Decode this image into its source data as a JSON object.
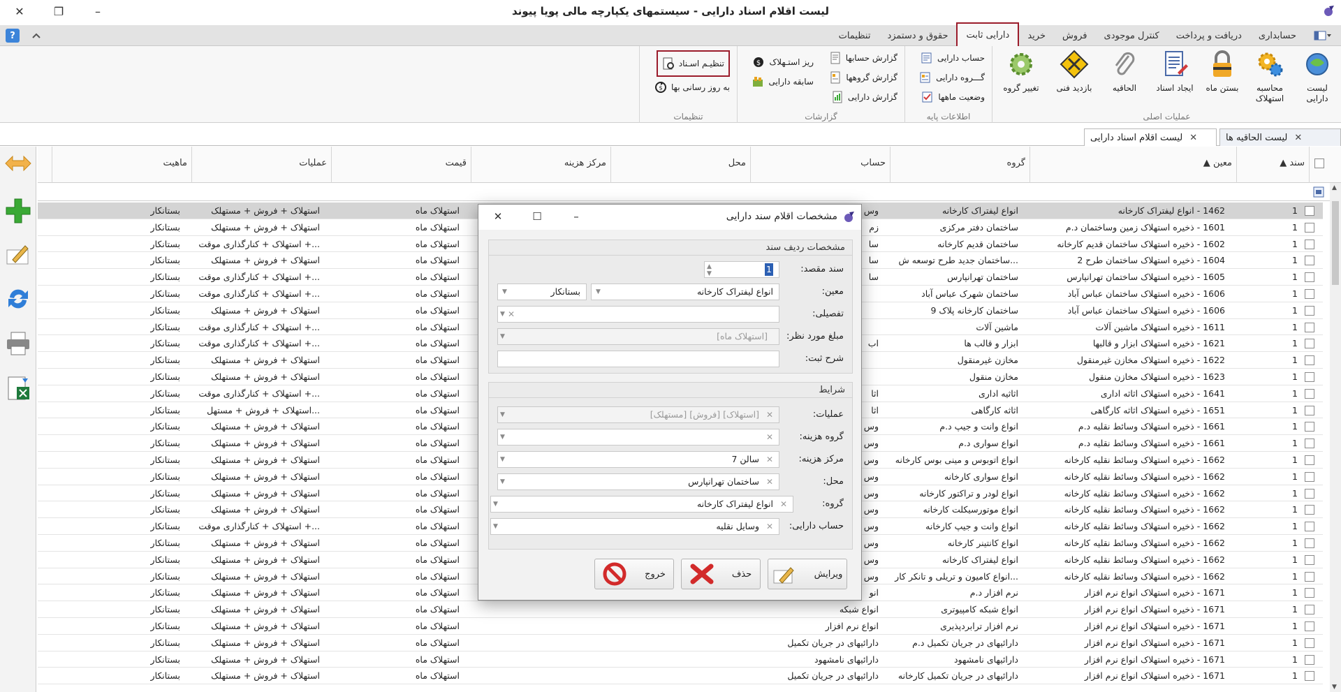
{
  "window": {
    "title": "لیست اقلام اسناد دارایی - سیستمهای یکپارچه مالی پویا پیوند",
    "controls": [
      "–",
      "❐",
      "✕"
    ]
  },
  "ribbon_tabs": [
    "حسابداری",
    "دریافت و پرداخت",
    "کنترل موجودی",
    "فروش",
    "خرید",
    "دارایی ثابت",
    "حقوق و دستمزد",
    "تنظیمات"
  ],
  "ribbon": {
    "groups": {
      "main_ops": "عملیات اصلی",
      "base_info": "اطلاعات پایه",
      "reports": "گزارشات",
      "settings": "تنظیمات"
    },
    "main_ops_buttons": [
      {
        "label": "لیست دارایی",
        "icon": "asset-list-icon"
      },
      {
        "label": "محاسبه استهلاک",
        "icon": "gears-icon"
      },
      {
        "label": "بستن ماه",
        "icon": "padlock-icon"
      },
      {
        "label": "ایجاد اسناد",
        "icon": "create-document-icon"
      },
      {
        "label": "الحاقیه",
        "icon": "paperclip-icon"
      },
      {
        "label": "بازدید فنی",
        "icon": "tools-sign-icon"
      },
      {
        "label": "تغییر گروه",
        "icon": "gear-change-icon"
      }
    ],
    "base_info_buttons": [
      {
        "label": "حساب دارایی",
        "icon": "account-icon"
      },
      {
        "label": "گـــروه دارایی",
        "icon": "group-icon"
      },
      {
        "label": "وضعیت ماهها",
        "icon": "month-status-icon"
      }
    ],
    "reports_buttons": [
      {
        "label": "گزارش حسابها",
        "icon": "report-icon"
      },
      {
        "label": "گزارش گروهها",
        "icon": "report-icon"
      },
      {
        "label": "گزارش دارایی",
        "icon": "report-icon"
      },
      {
        "label": "ریز استـهلاک",
        "icon": "depreciation-detail-icon"
      },
      {
        "label": "سابقه دارایی",
        "icon": "asset-history-icon"
      }
    ],
    "settings_buttons": [
      {
        "label": "تنظیـم اسـناد",
        "icon": "settings-doc-icon"
      },
      {
        "label": "به روز رسانی بها",
        "icon": "refresh-price-icon"
      }
    ]
  },
  "doc_tabs": [
    {
      "label": "لیست الحاقیه ها"
    },
    {
      "label": "لیست اقلام اسناد دارایی"
    }
  ],
  "grid": {
    "columns": [
      "سند",
      "معین",
      "گروه",
      "حساب",
      "محل",
      "مرکز هزینه",
      "قیمت",
      "عملیات",
      "ماهیت"
    ],
    "rows": [
      {
        "sanad": "1",
        "moein": "1462 - انواع لیفتراک کارخانه",
        "group": "انواع لیفتراک کارخانه",
        "hesab": "وس",
        "mahal": "",
        "markaz": "",
        "price": "استهلاک ماه",
        "amaliat": "استهلاک + فروش + مستهلک",
        "mahiat": "بستانکار"
      },
      {
        "sanad": "1",
        "moein": "1601 - ذخیره استهلاک زمین وساختمان د.م",
        "group": "ساختمان دفتر مرکزی",
        "hesab": "زم",
        "mahal": "",
        "markaz": "",
        "price": "استهلاک ماه",
        "amaliat": "استهلاک + فروش + مستهلک",
        "mahiat": "بستانکار"
      },
      {
        "sanad": "1",
        "moein": "1602 - ذخیره استهلاک ساختمان قدیم کارخانه",
        "group": "ساختمان قدیم کارخانه",
        "hesab": "سا",
        "mahal": "",
        "markaz": "",
        "price": "استهلاک ماه",
        "amaliat": "...+ استهلاک + کنارگذاری موقت",
        "mahiat": "بستانکار"
      },
      {
        "sanad": "1",
        "moein": "1604 - ذخیره استهلاک ساختمان طرح 2",
        "group": "...ساختمان جدید طرح توسعه ش",
        "hesab": "سا",
        "mahal": "",
        "markaz": "",
        "price": "استهلاک ماه",
        "amaliat": "استهلاک + فروش + مستهلک",
        "mahiat": "بستانکار"
      },
      {
        "sanad": "1",
        "moein": "1605 - ذخیره استهلاک ساختمان تهرانپارس",
        "group": "ساختمان تهرانپارس",
        "hesab": "سا",
        "mahal": "",
        "markaz": "",
        "price": "استهلاک ماه",
        "amaliat": "...+ استهلاک + کنارگذاری موقت",
        "mahiat": "بستانکار"
      },
      {
        "sanad": "1",
        "moein": "1606 - ذخیره استهلاک ساختمان عباس آباد",
        "group": "ساختمان شهرک عباس آباد",
        "hesab": "",
        "mahal": "",
        "markaz": "",
        "price": "استهلاک ماه",
        "amaliat": "...+ استهلاک + کنارگذاری موقت",
        "mahiat": "بستانکار"
      },
      {
        "sanad": "1",
        "moein": "1606 - ذخیره استهلاک ساختمان عباس آباد",
        "group": "ساختمان کارخانه پلاک 9",
        "hesab": "",
        "mahal": "",
        "markaz": "",
        "price": "استهلاک ماه",
        "amaliat": "استهلاک + فروش + مستهلک",
        "mahiat": "بستانکار"
      },
      {
        "sanad": "1",
        "moein": "1611 - ذخیره استهلاک ماشین آلات",
        "group": "ماشین آلات",
        "hesab": "",
        "mahal": "",
        "markaz": "",
        "price": "استهلاک ماه",
        "amaliat": "...+ استهلاک + کنارگذاری موقت",
        "mahiat": "بستانکار"
      },
      {
        "sanad": "1",
        "moein": "1621 - ذخیره استهلاک ابزار و قالبها",
        "group": "ابزار و قالب ها",
        "hesab": "اب",
        "mahal": "",
        "markaz": "",
        "price": "استهلاک ماه",
        "amaliat": "...+ استهلاک + کنارگذاری موقت",
        "mahiat": "بستانکار"
      },
      {
        "sanad": "1",
        "moein": "1622 - ذخیره استهلاک مخازن غیرمنقول",
        "group": "مخازن غیرمنقول",
        "hesab": "",
        "mahal": "",
        "markaz": "",
        "price": "استهلاک ماه",
        "amaliat": "استهلاک + فروش + مستهلک",
        "mahiat": "بستانکار"
      },
      {
        "sanad": "1",
        "moein": "1623 - ذخیره استهلاک مخازن منقول",
        "group": "مخازن منقول",
        "hesab": "",
        "mahal": "",
        "markaz": "",
        "price": "استهلاک ماه",
        "amaliat": "استهلاک + فروش + مستهلک",
        "mahiat": "بستانکار"
      },
      {
        "sanad": "1",
        "moein": "1641 - ذخیره استهلاک اثاثه اداری",
        "group": "اثاثیه اداری",
        "hesab": "اثا",
        "mahal": "",
        "markaz": "",
        "price": "استهلاک ماه",
        "amaliat": "...+ استهلاک + کنارگذاری موقت",
        "mahiat": "بستانکار"
      },
      {
        "sanad": "1",
        "moein": "1651 - ذخیره استهلاک اثاثه کارگاهی",
        "group": "اثاثه کارگاهی",
        "hesab": "اثا",
        "mahal": "",
        "markaz": "",
        "price": "استهلاک ماه",
        "amaliat": "...استهلاک + فروش + مستهل",
        "mahiat": "بستانکار"
      },
      {
        "sanad": "1",
        "moein": "1661 - ذخیره استهلاک وسائط نقلیه د.م",
        "group": "انواع وانت و جیپ د.م",
        "hesab": "وس",
        "mahal": "",
        "markaz": "",
        "price": "استهلاک ماه",
        "amaliat": "استهلاک + فروش + مستهلک",
        "mahiat": "بستانکار"
      },
      {
        "sanad": "1",
        "moein": "1661 - ذخیره استهلاک وسائط نقلیه د.م",
        "group": "انواع سواری د.م",
        "hesab": "وس",
        "mahal": "",
        "markaz": "",
        "price": "استهلاک ماه",
        "amaliat": "استهلاک + فروش + مستهلک",
        "mahiat": "بستانکار"
      },
      {
        "sanad": "1",
        "moein": "1662 - ذخیره استهلاک وسائط نقلیه کارخانه",
        "group": "انواع اتوبوس و مینی بوس کارخانه",
        "hesab": "وس",
        "mahal": "",
        "markaz": "",
        "price": "استهلاک ماه",
        "amaliat": "استهلاک + فروش + مستهلک",
        "mahiat": "بستانکار"
      },
      {
        "sanad": "1",
        "moein": "1662 - ذخیره استهلاک وسائط نقلیه کارخانه",
        "group": "انواع سواری کارخانه",
        "hesab": "وس",
        "mahal": "",
        "markaz": "",
        "price": "استهلاک ماه",
        "amaliat": "استهلاک + فروش + مستهلک",
        "mahiat": "بستانکار"
      },
      {
        "sanad": "1",
        "moein": "1662 - ذخیره استهلاک وسائط نقلیه کارخانه",
        "group": "انواع لودر و تراکتور کارخانه",
        "hesab": "وس",
        "mahal": "",
        "markaz": "",
        "price": "استهلاک ماه",
        "amaliat": "استهلاک + فروش + مستهلک",
        "mahiat": "بستانکار"
      },
      {
        "sanad": "1",
        "moein": "1662 - ذخیره استهلاک وسائط نقلیه کارخانه",
        "group": "انواع موتورسیکلت کارخانه",
        "hesab": "وس",
        "mahal": "",
        "markaz": "",
        "price": "استهلاک ماه",
        "amaliat": "استهلاک + فروش + مستهلک",
        "mahiat": "بستانکار"
      },
      {
        "sanad": "1",
        "moein": "1662 - ذخیره استهلاک وسائط نقلیه کارخانه",
        "group": "انواع وانت و جیپ کارخانه",
        "hesab": "وس",
        "mahal": "",
        "markaz": "",
        "price": "استهلاک ماه",
        "amaliat": "...+ استهلاک + کنارگذاری موقت",
        "mahiat": "بستانکار"
      },
      {
        "sanad": "1",
        "moein": "1662 - ذخیره استهلاک وسائط نقلیه کارخانه",
        "group": "انواع کانتینر کارخانه",
        "hesab": "وس",
        "mahal": "",
        "markaz": "",
        "price": "استهلاک ماه",
        "amaliat": "استهلاک + فروش + مستهلک",
        "mahiat": "بستانکار"
      },
      {
        "sanad": "1",
        "moein": "1662 - ذخیره استهلاک وسائط نقلیه کارخانه",
        "group": "انواع لیفتراک کارخانه",
        "hesab": "وس",
        "mahal": "",
        "markaz": "",
        "price": "استهلاک ماه",
        "amaliat": "استهلاک + فروش + مستهلک",
        "mahiat": "بستانکار"
      },
      {
        "sanad": "1",
        "moein": "1662 - ذخیره استهلاک وسائط نقلیه کارخانه",
        "group": "...انواع کامیون و تریلی و تانکر کار",
        "hesab": "وس",
        "mahal": "",
        "markaz": "",
        "price": "استهلاک ماه",
        "amaliat": "استهلاک + فروش + مستهلک",
        "mahiat": "بستانکار"
      },
      {
        "sanad": "1",
        "moein": "1671 - ذخیره استهلاک انواع نرم افزار",
        "group": "نرم افزار د.م",
        "hesab": "انو",
        "mahal": "",
        "markaz": "",
        "price": "استهلاک ماه",
        "amaliat": "استهلاک + فروش + مستهلک",
        "mahiat": "بستانکار"
      },
      {
        "sanad": "1",
        "moein": "1671 - ذخیره استهلاک انواع نرم افزار",
        "group": "انواع شبکه کامپیوتری",
        "hesab": "انواع شبکه",
        "mahal": "",
        "markaz": "",
        "price": "استهلاک ماه",
        "amaliat": "استهلاک + فروش + مستهلک",
        "mahiat": "بستانکار"
      },
      {
        "sanad": "1",
        "moein": "1671 - ذخیره استهلاک انواع نرم افزار",
        "group": "نرم افزار ترابردپذیری",
        "hesab": "انواع نرم افزار",
        "mahal": "",
        "markaz": "",
        "price": "استهلاک ماه",
        "amaliat": "استهلاک + فروش + مستهلک",
        "mahiat": "بستانکار"
      },
      {
        "sanad": "1",
        "moein": "1671 - ذخیره استهلاک انواع نرم افزار",
        "group": "دارائیهای در جریان تکمیل د.م",
        "hesab": "دارائیهای در جریان تکمیل",
        "mahal": "",
        "markaz": "",
        "price": "استهلاک ماه",
        "amaliat": "استهلاک + فروش + مستهلک",
        "mahiat": "بستانکار"
      },
      {
        "sanad": "1",
        "moein": "1671 - ذخیره استهلاک انواع نرم افزار",
        "group": "دارائیهای نامشهود",
        "hesab": "دارائیهای نامشهود",
        "mahal": "",
        "markaz": "",
        "price": "استهلاک ماه",
        "amaliat": "استهلاک + فروش + مستهلک",
        "mahiat": "بستانکار"
      },
      {
        "sanad": "1",
        "moein": "1671 - ذخیره استهلاک انواع نرم افزار",
        "group": "دارائیهای در جریان تکمیل کارخانه",
        "hesab": "دارائیهای در جریان تکمیل",
        "mahal": "",
        "markaz": "",
        "price": "استهلاک ماه",
        "amaliat": "استهلاک + فروش + مستهلک",
        "mahiat": "بستانکار"
      }
    ]
  },
  "dialog": {
    "title": "مشخصات اقلام سند دارایی",
    "section_row": "مشخصات ردیف سند",
    "section_conditions": "شرایط",
    "fields": {
      "target_doc_label": "سند مقصد:",
      "target_doc_value": "1",
      "moein_label": "معین:",
      "moein_value": "انواع لیفتراک کارخانه",
      "nature_value": "بستانکار",
      "tafsili_label": "تفصیلی:",
      "amount_label": "مبلغ مورد نظر:",
      "amount_value": "[استهلاک ماه]",
      "desc_label": "شرح ثبت:",
      "ops_label": "عملیات:",
      "ops_value": "[استهلاک] [فروش] [مستهلک]",
      "cost_group_label": "گروه هزینه:",
      "cost_center_label": "مرکز هزینه:",
      "cost_center_value": "سالن 7",
      "location_label": "محل:",
      "location_value": "ساختمان تهرانپارس",
      "group_label": "گروه:",
      "group_value": "انواع لیفتراک کارخانه",
      "asset_account_label": "حساب دارایی:",
      "asset_account_value": "وسایل نقلیه"
    },
    "buttons": {
      "edit": "ویرایش",
      "delete": "حذف",
      "exit": "خروج"
    }
  },
  "colors": {
    "accent_red": "#9b1c2b",
    "selected_row": "#d4d4d4",
    "add_green": "#3aa935"
  }
}
